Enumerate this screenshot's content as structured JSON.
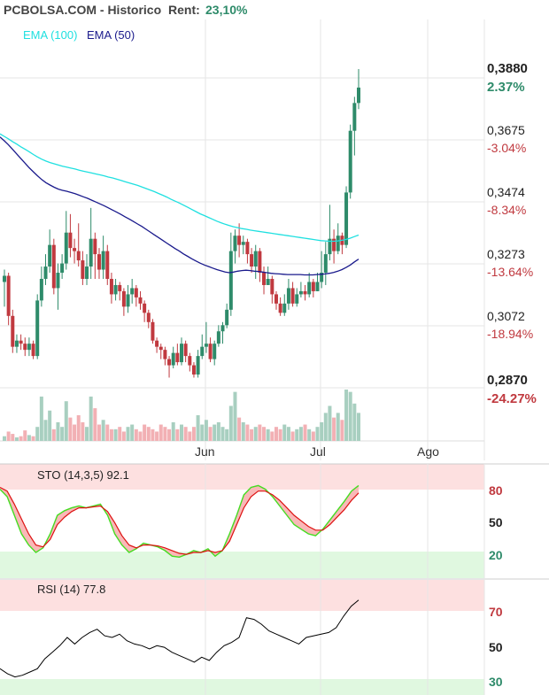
{
  "header": {
    "site": "PCBOLSA.COM - Historico",
    "rent_label": "Rent:",
    "rent_value": "23,10%"
  },
  "colors": {
    "up": "#2e8b6a",
    "down": "#c0393f",
    "ema100": "#1fe0e0",
    "ema50": "#1a1a8c",
    "rent": "#2e8b6a",
    "pos": "#2e8b6a",
    "neg": "#c0393f",
    "grid": "#e6e6e6",
    "over_zone": "#fde0e0",
    "under_zone": "#e0f8e0",
    "rsi_line": "#000000",
    "sto_k": "#44dd22",
    "sto_d": "#dd1111"
  },
  "chart_data": [
    {
      "type": "candlestick",
      "legend": [
        {
          "name": "EMA (100)",
          "color": "#1fe0e0"
        },
        {
          "name": "EMA (50)",
          "color": "#1a1a8c"
        }
      ],
      "x_ticks": [
        "Jun",
        "Jul",
        "Ago"
      ],
      "price_ticks": [
        "0,3880",
        "0,3675",
        "0,3474",
        "0,3273",
        "0,3072",
        "0,2870"
      ],
      "pct_ticks": [
        "2.37%",
        "-3.04%",
        "-8.34%",
        "-13.64%",
        "-18.94%",
        "-24.27%"
      ],
      "ylim": [
        0.287,
        0.388
      ],
      "candles": [
        [
          0.319,
          0.321,
          0.323,
          0.311
        ],
        [
          0.321,
          0.308,
          0.322,
          0.305
        ],
        [
          0.308,
          0.298,
          0.31,
          0.296
        ],
        [
          0.298,
          0.3,
          0.302,
          0.296
        ],
        [
          0.3,
          0.299,
          0.302,
          0.297
        ],
        [
          0.299,
          0.297,
          0.301,
          0.295
        ],
        [
          0.297,
          0.299,
          0.301,
          0.295
        ],
        [
          0.299,
          0.295,
          0.3,
          0.294
        ],
        [
          0.295,
          0.313,
          0.315,
          0.294
        ],
        [
          0.313,
          0.32,
          0.324,
          0.311
        ],
        [
          0.32,
          0.324,
          0.328,
          0.318
        ],
        [
          0.324,
          0.331,
          0.336,
          0.322
        ],
        [
          0.331,
          0.317,
          0.333,
          0.315
        ],
        [
          0.317,
          0.322,
          0.325,
          0.31
        ],
        [
          0.322,
          0.325,
          0.328,
          0.32
        ],
        [
          0.325,
          0.335,
          0.342,
          0.323
        ],
        [
          0.335,
          0.33,
          0.341,
          0.327
        ],
        [
          0.33,
          0.329,
          0.333,
          0.325
        ],
        [
          0.329,
          0.326,
          0.338,
          0.324
        ],
        [
          0.326,
          0.32,
          0.329,
          0.318
        ],
        [
          0.32,
          0.324,
          0.328,
          0.318
        ],
        [
          0.324,
          0.333,
          0.343,
          0.32
        ],
        [
          0.333,
          0.328,
          0.335,
          0.32
        ],
        [
          0.328,
          0.323,
          0.33,
          0.32
        ],
        [
          0.323,
          0.329,
          0.334,
          0.32
        ],
        [
          0.329,
          0.32,
          0.331,
          0.318
        ],
        [
          0.32,
          0.315,
          0.322,
          0.312
        ],
        [
          0.315,
          0.318,
          0.32,
          0.313
        ],
        [
          0.318,
          0.316,
          0.319,
          0.313
        ],
        [
          0.316,
          0.311,
          0.317,
          0.308
        ],
        [
          0.311,
          0.315,
          0.318,
          0.309
        ],
        [
          0.315,
          0.317,
          0.32,
          0.312
        ],
        [
          0.317,
          0.314,
          0.318,
          0.311
        ],
        [
          0.314,
          0.312,
          0.316,
          0.31
        ],
        [
          0.312,
          0.309,
          0.313,
          0.306
        ],
        [
          0.309,
          0.306,
          0.31,
          0.304
        ],
        [
          0.306,
          0.3,
          0.307,
          0.299
        ],
        [
          0.3,
          0.298,
          0.301,
          0.296
        ],
        [
          0.298,
          0.297,
          0.299,
          0.294
        ],
        [
          0.297,
          0.294,
          0.298,
          0.292
        ],
        [
          0.294,
          0.292,
          0.295,
          0.288
        ],
        [
          0.292,
          0.296,
          0.298,
          0.291
        ],
        [
          0.296,
          0.293,
          0.299,
          0.292
        ],
        [
          0.293,
          0.299,
          0.301,
          0.292
        ],
        [
          0.299,
          0.295,
          0.3,
          0.293
        ],
        [
          0.295,
          0.292,
          0.296,
          0.29
        ],
        [
          0.292,
          0.289,
          0.293,
          0.288
        ],
        [
          0.289,
          0.295,
          0.297,
          0.288
        ],
        [
          0.295,
          0.298,
          0.302,
          0.294
        ],
        [
          0.298,
          0.299,
          0.306,
          0.296
        ],
        [
          0.299,
          0.294,
          0.301,
          0.293
        ],
        [
          0.294,
          0.299,
          0.3,
          0.292
        ],
        [
          0.299,
          0.303,
          0.305,
          0.298
        ],
        [
          0.303,
          0.305,
          0.306,
          0.299
        ],
        [
          0.305,
          0.31,
          0.312,
          0.304
        ],
        [
          0.31,
          0.329,
          0.335,
          0.308
        ],
        [
          0.329,
          0.334,
          0.336,
          0.325
        ],
        [
          0.334,
          0.331,
          0.338,
          0.327
        ],
        [
          0.331,
          0.332,
          0.334,
          0.328
        ],
        [
          0.332,
          0.328,
          0.333,
          0.325
        ],
        [
          0.328,
          0.324,
          0.33,
          0.322
        ],
        [
          0.324,
          0.329,
          0.331,
          0.32
        ],
        [
          0.329,
          0.322,
          0.33,
          0.319
        ],
        [
          0.322,
          0.318,
          0.324,
          0.315
        ],
        [
          0.318,
          0.32,
          0.324,
          0.318
        ],
        [
          0.32,
          0.315,
          0.321,
          0.312
        ],
        [
          0.315,
          0.312,
          0.316,
          0.31
        ],
        [
          0.312,
          0.309,
          0.314,
          0.308
        ],
        [
          0.309,
          0.312,
          0.315,
          0.308
        ],
        [
          0.312,
          0.317,
          0.32,
          0.31
        ],
        [
          0.317,
          0.312,
          0.319,
          0.311
        ],
        [
          0.312,
          0.315,
          0.317,
          0.311
        ],
        [
          0.315,
          0.316,
          0.319,
          0.314
        ],
        [
          0.316,
          0.315,
          0.318,
          0.313
        ],
        [
          0.315,
          0.319,
          0.322,
          0.314
        ],
        [
          0.319,
          0.316,
          0.32,
          0.314
        ],
        [
          0.316,
          0.319,
          0.322,
          0.316
        ],
        [
          0.319,
          0.322,
          0.329,
          0.317
        ],
        [
          0.322,
          0.328,
          0.332,
          0.318
        ],
        [
          0.328,
          0.333,
          0.344,
          0.326
        ],
        [
          0.333,
          0.329,
          0.336,
          0.325
        ],
        [
          0.329,
          0.334,
          0.338,
          0.328
        ],
        [
          0.334,
          0.331,
          0.335,
          0.328
        ],
        [
          0.331,
          0.348,
          0.35,
          0.33
        ],
        [
          0.348,
          0.368,
          0.37,
          0.346
        ],
        [
          0.368,
          0.377,
          0.379,
          0.36
        ],
        [
          0.377,
          0.382,
          0.388,
          0.375
        ]
      ],
      "volume": [
        4,
        8,
        6,
        3,
        4,
        9,
        5,
        4,
        12,
        38,
        18,
        26,
        10,
        16,
        12,
        34,
        20,
        14,
        22,
        16,
        12,
        38,
        28,
        14,
        18,
        14,
        10,
        10,
        12,
        8,
        12,
        14,
        10,
        8,
        14,
        12,
        10,
        8,
        14,
        12,
        10,
        16,
        10,
        14,
        12,
        8,
        12,
        22,
        14,
        18,
        12,
        14,
        16,
        12,
        10,
        30,
        42,
        20,
        16,
        14,
        10,
        12,
        14,
        12,
        10,
        8,
        12,
        10,
        14,
        12,
        8,
        10,
        12,
        14,
        10,
        8,
        12,
        16,
        24,
        30,
        20,
        24,
        18,
        44,
        42,
        32,
        24
      ],
      "ema100": [
        0.367,
        0.3662,
        0.3654,
        0.3645,
        0.3637,
        0.3628,
        0.362,
        0.3612,
        0.3603,
        0.3595,
        0.3588,
        0.3582,
        0.3577,
        0.3573,
        0.3569,
        0.3565,
        0.3562,
        0.3559,
        0.3556,
        0.3552,
        0.3549,
        0.3546,
        0.3543,
        0.354,
        0.3537,
        0.3534,
        0.353,
        0.3527,
        0.3523,
        0.3519,
        0.3515,
        0.3511,
        0.3507,
        0.3503,
        0.3498,
        0.3493,
        0.3488,
        0.3483,
        0.3477,
        0.3471,
        0.3465,
        0.3458,
        0.3452,
        0.3446,
        0.3439,
        0.3432,
        0.3425,
        0.3418,
        0.3411,
        0.3405,
        0.3399,
        0.3393,
        0.3387,
        0.3382,
        0.3377,
        0.3373,
        0.3369,
        0.3366,
        0.3363,
        0.3361,
        0.3358,
        0.3356,
        0.3354,
        0.3352,
        0.335,
        0.3348,
        0.3346,
        0.3344,
        0.3342,
        0.334,
        0.3338,
        0.3336,
        0.3334,
        0.3332,
        0.333,
        0.3328,
        0.3326,
        0.3324,
        0.3323,
        0.3322,
        0.3322,
        0.3323,
        0.3325,
        0.3328,
        0.3332,
        0.3337,
        0.3342
      ],
      "ema50": [
        0.366,
        0.3648,
        0.3635,
        0.362,
        0.3605,
        0.359,
        0.3575,
        0.356,
        0.3547,
        0.3534,
        0.3522,
        0.3512,
        0.3504,
        0.3497,
        0.3491,
        0.3487,
        0.3484,
        0.348,
        0.3476,
        0.3471,
        0.3466,
        0.3461,
        0.3455,
        0.3449,
        0.3443,
        0.3437,
        0.343,
        0.3423,
        0.3416,
        0.3409,
        0.3401,
        0.3394,
        0.3386,
        0.3378,
        0.337,
        0.3361,
        0.3352,
        0.3343,
        0.3334,
        0.3325,
        0.3316,
        0.3307,
        0.3298,
        0.329,
        0.3281,
        0.3273,
        0.3265,
        0.3258,
        0.3251,
        0.3245,
        0.324,
        0.3235,
        0.323,
        0.3226,
        0.3222,
        0.322,
        0.3222,
        0.3225,
        0.3227,
        0.3228,
        0.3227,
        0.3225,
        0.3224,
        0.3222,
        0.322,
        0.3218,
        0.3217,
        0.3216,
        0.3215,
        0.3214,
        0.3214,
        0.3214,
        0.3214,
        0.3213,
        0.3213,
        0.3213,
        0.3214,
        0.3215,
        0.3216,
        0.3218,
        0.3221,
        0.3225,
        0.323,
        0.3237,
        0.3245,
        0.3255,
        0.3264
      ]
    },
    {
      "type": "line",
      "label": "STO (14,3,5) 92.1",
      "ticks": [
        "80",
        "50",
        "20"
      ],
      "ylim": [
        0,
        100
      ],
      "k": [
        88,
        80,
        60,
        40,
        28,
        20,
        25,
        40,
        60,
        65,
        68,
        70,
        68,
        70,
        72,
        60,
        40,
        28,
        20,
        24,
        30,
        28,
        26,
        22,
        16,
        15,
        18,
        22,
        20,
        24,
        16,
        22,
        40,
        60,
        82,
        90,
        92,
        88,
        80,
        70,
        60,
        50,
        45,
        40,
        38,
        45,
        55,
        65,
        75,
        86,
        92
      ],
      "d": [
        90,
        86,
        72,
        56,
        40,
        28,
        26,
        34,
        50,
        58,
        64,
        68,
        68,
        69,
        70,
        64,
        52,
        38,
        28,
        25,
        28,
        28,
        27,
        25,
        22,
        19,
        18,
        20,
        20,
        22,
        20,
        22,
        32,
        50,
        68,
        80,
        86,
        86,
        82,
        76,
        68,
        60,
        54,
        48,
        44,
        44,
        50,
        58,
        66,
        76,
        84
      ]
    },
    {
      "type": "line",
      "label": "RSI (14) 77.8",
      "ticks": [
        "70",
        "50",
        "30"
      ],
      "ylim": [
        20,
        90
      ],
      "values": [
        36,
        33,
        31,
        32,
        34,
        36,
        42,
        46,
        50,
        55,
        51,
        55,
        58,
        60,
        56,
        55,
        57,
        53,
        51,
        50,
        48,
        50,
        49,
        46,
        44,
        42,
        40,
        43,
        41,
        46,
        50,
        52,
        55,
        67,
        66,
        63,
        59,
        57,
        55,
        53,
        51,
        55,
        56,
        57,
        58,
        61,
        68,
        74,
        77.8
      ]
    }
  ]
}
